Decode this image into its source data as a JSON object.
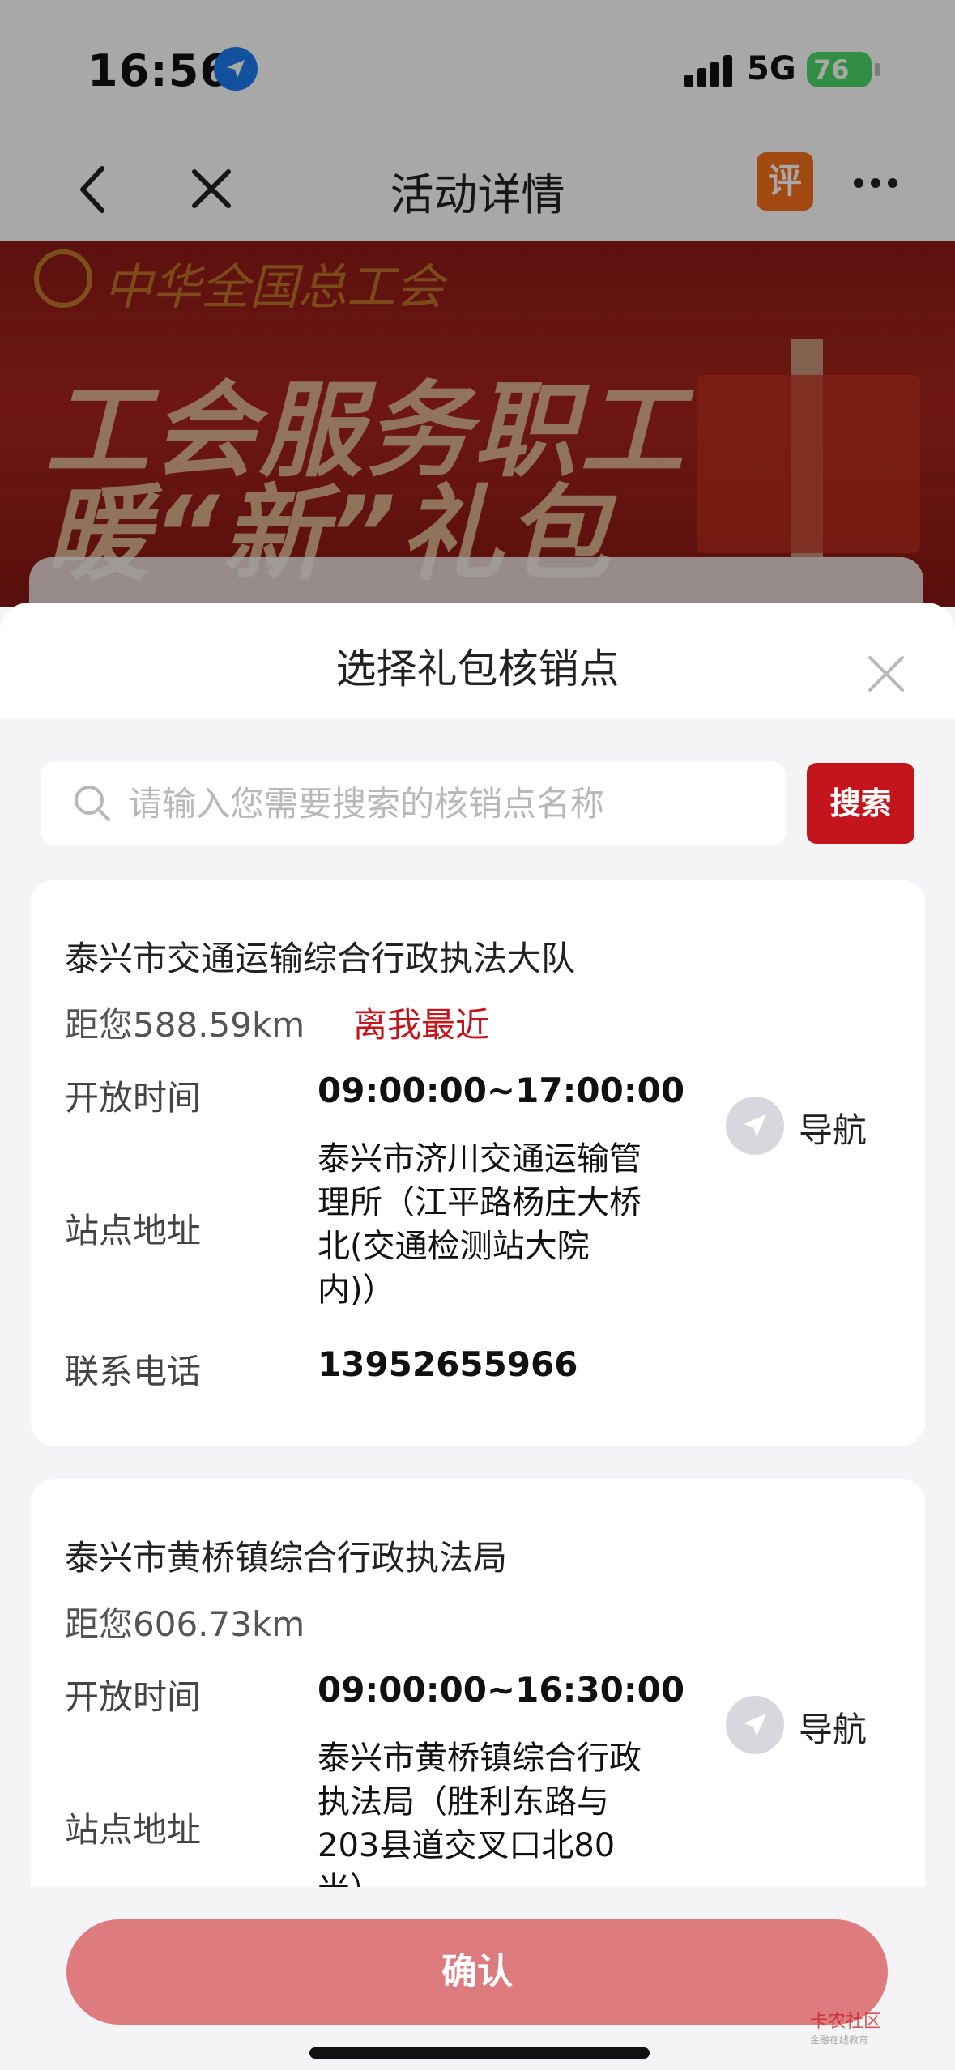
{
  "status": {
    "time": "16:56",
    "network": "5G",
    "battery": "76"
  },
  "nav": {
    "title": "活动详情",
    "rate_label": "评"
  },
  "banner": {
    "org": "中华全国总工会",
    "line1": "工会服务职工",
    "line2": "暖“新”礼包"
  },
  "sheet": {
    "title": "选择礼包核销点",
    "search_placeholder": "请输入您需要搜索的核销点名称",
    "search_button": "搜索",
    "confirm": "确认"
  },
  "labels": {
    "open_time": "开放时间",
    "address": "站点地址",
    "phone": "联系电话",
    "navigate": "导航"
  },
  "sites": [
    {
      "name": "泰兴市交通运输综合行政执法大队",
      "distance": "距您588.59km",
      "tag": "离我最近",
      "hours": "09:00:00~17:00:00",
      "address_lines": [
        "泰兴市济川交通运输管",
        "理所（江平路杨庄大桥",
        "北(交通检测站大院",
        "内)）"
      ],
      "phone": "13952655966"
    },
    {
      "name": "泰兴市黄桥镇综合行政执法局",
      "distance": "距您606.73km",
      "hours": "09:00:00~16:30:00",
      "address_lines": [
        "泰兴市黄桥镇综合行政",
        "执法局（胜利东路与",
        "203县道交叉口北80",
        "米）"
      ]
    }
  ],
  "watermark": {
    "title": "卡农社区",
    "subtitle": "金融在线教育"
  }
}
